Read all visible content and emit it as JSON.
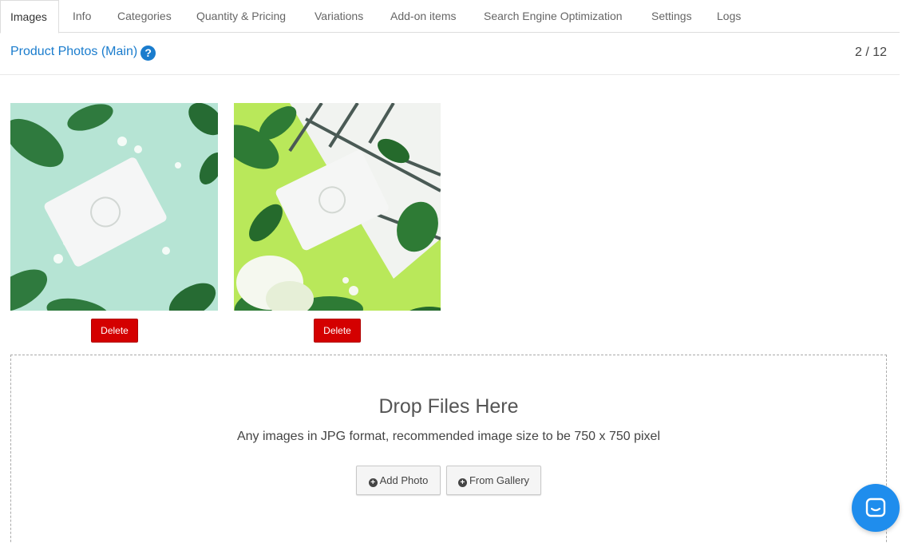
{
  "tabs": [
    {
      "label": "Images",
      "active": true
    },
    {
      "label": "Info"
    },
    {
      "label": "Categories"
    },
    {
      "label": "Quantity & Pricing"
    },
    {
      "label": "Variations"
    },
    {
      "label": "Add-on items"
    },
    {
      "label": "Search Engine Optimization"
    },
    {
      "label": "Settings"
    },
    {
      "label": "Logs"
    }
  ],
  "section": {
    "title": "Product Photos (Main)",
    "help_icon": "question-circle-icon",
    "counter": "2 / 12"
  },
  "photos": [
    {
      "delete_label": "Delete"
    },
    {
      "delete_label": "Delete"
    }
  ],
  "dropzone": {
    "title": "Drop Files Here",
    "hint": "Any images in JPG format, recommended image size to be 750 x 750 pixel",
    "add_photo_label": "Add Photo",
    "from_gallery_label": "From Gallery"
  },
  "colors": {
    "accent": "#1a7ccd",
    "delete": "#d40000",
    "chat": "#1f8ded"
  },
  "chat": {
    "icon": "chat-bubble-icon"
  }
}
